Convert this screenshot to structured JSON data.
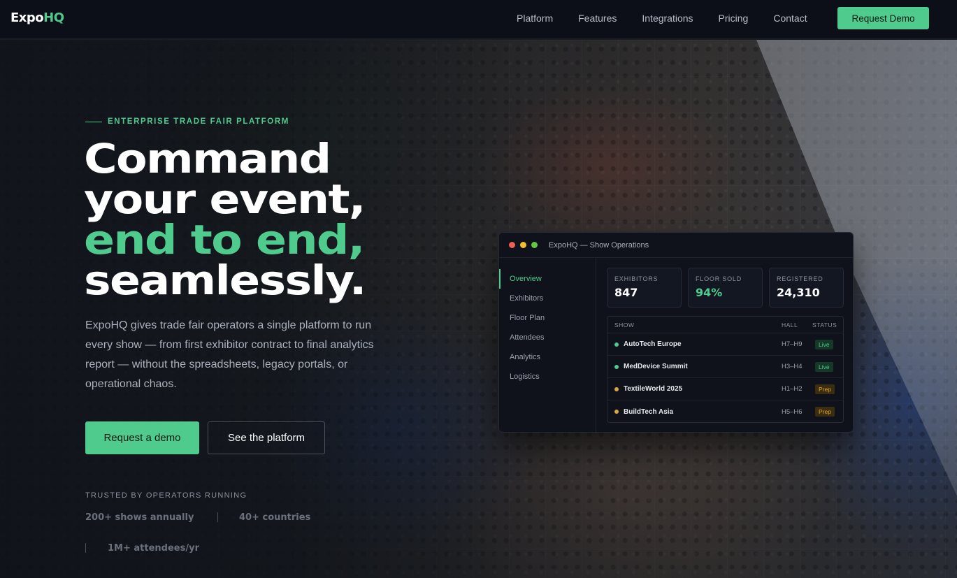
{
  "nav": {
    "logo_main": "Expo",
    "logo_accent": "HQ",
    "links": [
      "Platform",
      "Features",
      "Integrations",
      "Pricing",
      "Contact"
    ],
    "cta_label": "Request Demo"
  },
  "hero": {
    "eyebrow": "ENTERPRISE TRADE FAIR PLATFORM",
    "headline": [
      "Command",
      "your event,",
      "end to end,",
      "seamlessly."
    ],
    "subheadline": "ExpoHQ gives trade fair operators a single platform to run every show — from first exhibitor contract to final analytics report — without the spreadsheets, legacy portals, or operational chaos.",
    "primary_cta": "Request a demo",
    "secondary_cta": "See the platform",
    "trusted_label": "TRUSTED BY OPERATORS RUNNING",
    "stats": [
      "200+ shows annually",
      "40+ countries",
      "1M+ attendees/yr"
    ]
  },
  "dashboard": {
    "window_title": "ExpoHQ — Show Operations",
    "window_dots": [
      "#ed5f57",
      "#f5bd2f",
      "#5fc941"
    ],
    "sidebar": [
      "Overview",
      "Exhibitors",
      "Floor Plan",
      "Attendees",
      "Analytics",
      "Logistics"
    ],
    "active_item": "Overview",
    "kpis": [
      {
        "label": "EXHIBITORS",
        "value": "847"
      },
      {
        "label": "FLOOR SOLD",
        "value": "94%"
      },
      {
        "label": "REGISTERED",
        "value": "24,310"
      }
    ],
    "table": {
      "headers": [
        "SHOW",
        "HALL",
        "STATUS"
      ],
      "rows": [
        {
          "show": "AutoTech Europe",
          "hall": "H7–H9",
          "status": "Live",
          "dot_color": "#4ecb8d"
        },
        {
          "show": "MedDevice Summit",
          "hall": "H3–H4",
          "status": "Live",
          "dot_color": "#4ecb8d"
        },
        {
          "show": "TextileWorld 2025",
          "hall": "H1–H2",
          "status": "Prep",
          "dot_color": "#e0a63a"
        },
        {
          "show": "BuildTech Asia",
          "hall": "H5–H6",
          "status": "Prep",
          "dot_color": "#e0a63a"
        }
      ]
    }
  },
  "colors": {
    "accent": "#4ecb8d",
    "nav_bg": "#0c0f17",
    "prep": "#e0a63a"
  }
}
